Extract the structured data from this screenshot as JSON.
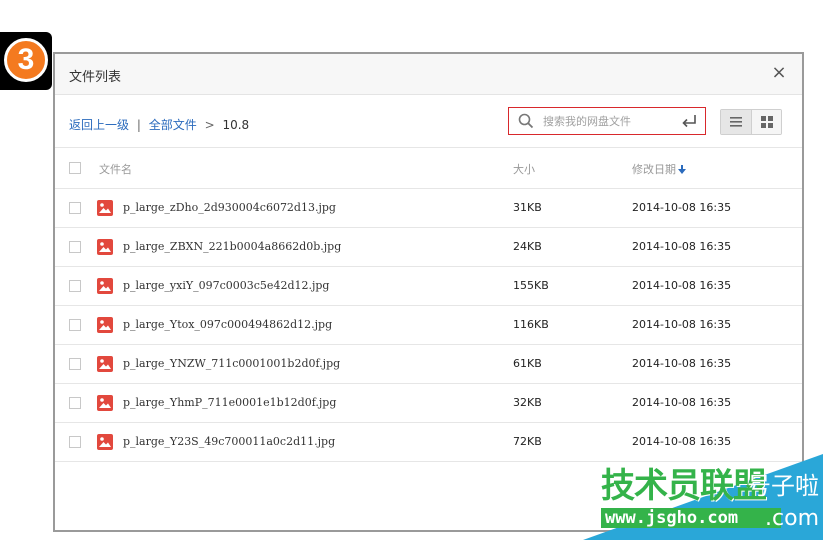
{
  "step_badge": {
    "number": "3",
    "color": "#f47a20"
  },
  "dialog": {
    "title": "文件列表",
    "close_label": "×"
  },
  "breadcrumb": {
    "back": "返回上一级",
    "separator": "|",
    "all_files": "全部文件",
    "arrow": ">",
    "current": "10.8"
  },
  "search": {
    "placeholder": "搜索我的网盘文件",
    "border_color": "#d8282c"
  },
  "view_toggle": {
    "active": "list",
    "options": [
      "list",
      "grid"
    ]
  },
  "table": {
    "headers": {
      "name": "文件名",
      "size": "大小",
      "date": "修改日期"
    },
    "sort": {
      "column": "date",
      "direction": "desc"
    },
    "rows": [
      {
        "name": "p_large_zDho_2d930004c6072d13.jpg",
        "size": "31KB",
        "date": "2014-10-08 16:35"
      },
      {
        "name": "p_large_ZBXN_221b0004a8662d0b.jpg",
        "size": "24KB",
        "date": "2014-10-08 16:35"
      },
      {
        "name": "p_large_yxiY_097c0003c5e42d12.jpg",
        "size": "155KB",
        "date": "2014-10-08 16:35"
      },
      {
        "name": "p_large_Ytox_097c000494862d12.jpg",
        "size": "116KB",
        "date": "2014-10-08 16:35"
      },
      {
        "name": "p_large_YNZW_711c0001001b2d0f.jpg",
        "size": "61KB",
        "date": "2014-10-08 16:35"
      },
      {
        "name": "p_large_YhmP_711e0001e1b12d0f.jpg",
        "size": "32KB",
        "date": "2014-10-08 16:35"
      },
      {
        "name": "p_large_Y23S_49c700011a0c2d11.jpg",
        "size": "72KB",
        "date": "2014-10-08 16:35"
      }
    ]
  },
  "watermark": {
    "main": "技术员联盟",
    "side": "号子啦",
    "url": "www.jsgho.com",
    "suffix": ".com"
  },
  "icons": {
    "file": "image-file-icon",
    "file_color": "#e2483d",
    "search": "search-icon",
    "enter": "enter-icon",
    "close": "close-icon",
    "sort": "arrow-down-icon"
  }
}
